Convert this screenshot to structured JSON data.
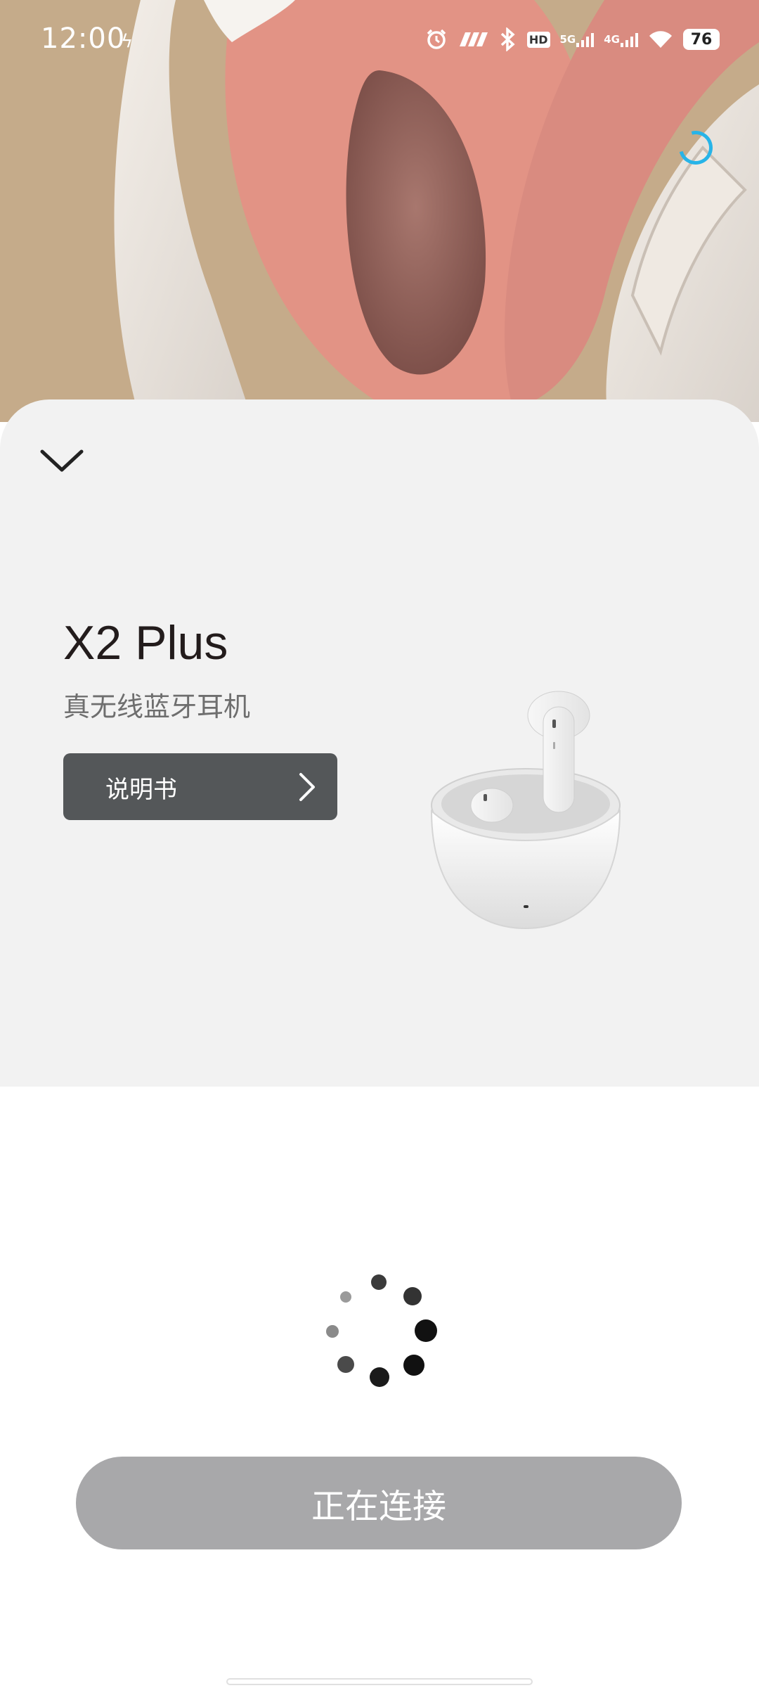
{
  "status_bar": {
    "time": "12:00",
    "battery": "76",
    "icons": [
      "lightning-icon",
      "alarm-icon",
      "nfc-icon",
      "bluetooth-icon",
      "hd-icon",
      "signal-5g-icon",
      "signal-4g-icon",
      "wifi-icon",
      "battery-icon"
    ],
    "hd_label": "HD",
    "net1_label": "5G",
    "net2_label": "4G"
  },
  "device": {
    "name": "X2 Plus",
    "description": "真无线蓝牙耳机",
    "manual_label": "说明书"
  },
  "connect": {
    "label": "正在连接"
  },
  "colors": {
    "hero_bg": "#c5ab8a",
    "sheet_bg": "#f2f2f2",
    "manual_button": "#545759",
    "connect_button": "#a8a8aa",
    "accent_spinner": "#27b4e8"
  }
}
